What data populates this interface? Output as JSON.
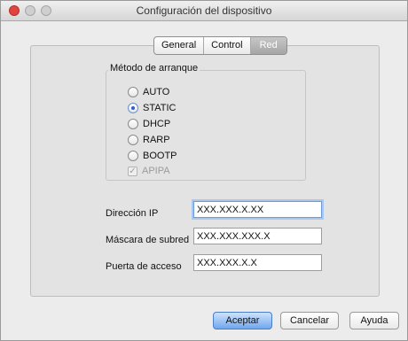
{
  "window": {
    "title": "Configuración del dispositivo"
  },
  "tabs": [
    {
      "label": "General",
      "selected": false
    },
    {
      "label": "Control",
      "selected": false
    },
    {
      "label": "Red",
      "selected": true
    }
  ],
  "boot_method": {
    "title": "Método de arranque",
    "options": [
      {
        "label": "AUTO",
        "selected": false
      },
      {
        "label": "STATIC",
        "selected": true
      },
      {
        "label": "DHCP",
        "selected": false
      },
      {
        "label": "RARP",
        "selected": false
      },
      {
        "label": "BOOTP",
        "selected": false
      }
    ],
    "apipa": {
      "label": "APIPA",
      "checked": true,
      "disabled": true
    }
  },
  "fields": {
    "ip": {
      "label": "Dirección IP",
      "value": "XXX.XXX.X.XX"
    },
    "subnet": {
      "label": "Máscara de subred",
      "value": "XXX.XXX.XXX.X"
    },
    "gateway": {
      "label": "Puerta de acceso",
      "value": "XXX.XXX.X.X"
    }
  },
  "buttons": {
    "accept": "Aceptar",
    "cancel": "Cancelar",
    "help": "Ayuda"
  },
  "colors": {
    "close": "#e0443e",
    "default_button": "#6fa8ef",
    "radio_dot": "#2a62c9"
  }
}
